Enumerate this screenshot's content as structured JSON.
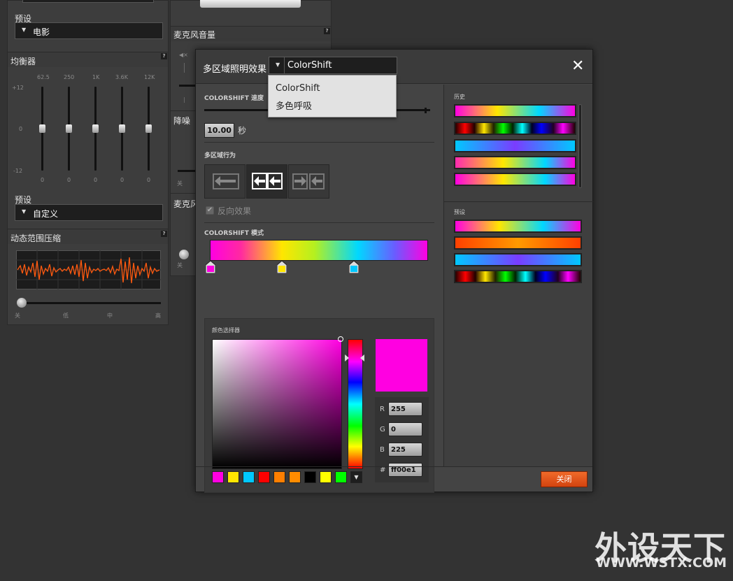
{
  "background": {
    "preset_label_1": "预设",
    "preset_value_1": "电影",
    "equalizer_title": "均衡器",
    "eq_bands": [
      "62.5",
      "250",
      "1K",
      "3.6K",
      "12K"
    ],
    "eq_scale": [
      "+12",
      "0",
      "-12"
    ],
    "eq_values": [
      "0",
      "0",
      "0",
      "0",
      "0"
    ],
    "preset_label_2": "预设",
    "preset_value_2": "自定义",
    "drc_title": "动态范围压缩",
    "drc_ticks": [
      "关",
      "低",
      "中",
      "高"
    ],
    "mic_volume_title": "麦克风音量",
    "noise_title": "降噪",
    "noise_off": "关",
    "mic_title_2": "麦克风",
    "mic_off": "关",
    "help": "?"
  },
  "dialog": {
    "title": "多区域照明效果",
    "effect_selected": "ColorShift",
    "effect_options": [
      "ColorShift",
      "多色呼吸"
    ],
    "close_symbol": "✕",
    "speed_label": "COLORSHIFT 速度",
    "speed_value": "10.00",
    "speed_unit": "秒",
    "behavior_label": "多区域行为",
    "reverse_label": "反向效果",
    "mode_label": "COLORSHIFT 模式",
    "picker_label": "颜色选择器",
    "rgb": {
      "r_label": "R",
      "r": "255",
      "g_label": "G",
      "g": "0",
      "b_label": "B",
      "b": "225",
      "hex_label": "#",
      "hex": "ff00e1"
    },
    "current_color": "#ff00e1",
    "swatches": [
      "#ff00e1",
      "#ffe600",
      "#00c8ff",
      "#ff0000",
      "#ff7f00",
      "#ff8c00",
      "#000000",
      "#ffff00",
      "#00ff00"
    ],
    "history_label": "历史",
    "presets_label": "预设",
    "close_button": "关闭"
  },
  "watermark": {
    "cn": "外设天下",
    "en": "WWW.WSTX.COM"
  }
}
